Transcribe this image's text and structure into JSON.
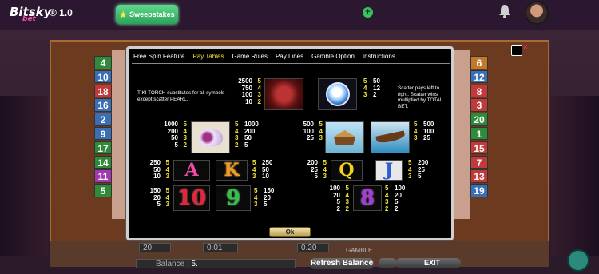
{
  "app": {
    "logo": "Bitsky",
    "logo_sub": "bet",
    "version": "® 1.0",
    "sweepstakes_label": "Sweepstakes",
    "icons": [
      "star-icon",
      "plus-icon",
      "bell-icon",
      "avatar"
    ]
  },
  "game": {
    "left_numbers": [
      "4",
      "10",
      "18",
      "16",
      "2",
      "9",
      "17",
      "14",
      "11",
      "5"
    ],
    "right_numbers": [
      "6",
      "12",
      "8",
      "3",
      "20",
      "1",
      "15",
      "7",
      "13",
      "19"
    ],
    "left_colors": [
      "#2f8a3a",
      "#3a6fb8",
      "#c03a3a",
      "#3a6fb8",
      "#3a6fb8",
      "#3a6fb8",
      "#2f8a3a",
      "#2f8a3a",
      "#a03ab0",
      "#2f8a3a"
    ],
    "right_colors": [
      "#c07a2a",
      "#3a6fb8",
      "#c03a3a",
      "#c03a3a",
      "#2f8a3a",
      "#2f8a3a",
      "#c03a3a",
      "#c03a3a",
      "#c03a3a",
      "#3a6fb8"
    ],
    "bottom": {
      "bet1": "20",
      "bet2": "0.01",
      "bet3": "0.20",
      "balance_label": "Balance :",
      "balance_value": "5.",
      "gamble_label": "GAMBLE",
      "refresh_label": "Refresh Balance",
      "exit_label": "EXIT"
    }
  },
  "dialog": {
    "tabs": [
      "Free Spin Feature",
      "Pay Tables",
      "Game Rules",
      "Pay Lines",
      "Gamble Option",
      "Instructions"
    ],
    "active_tab": "Pay Tables",
    "close_label": "×",
    "ok_label": "Ok",
    "tiki_text": "TIKI TORCH substitutes for all symbols except scatter PEARL.",
    "scatter_text": "Scatter pays left to right. Scatter wins multiplied by TOTAL BET.",
    "tiki": {
      "counts": [
        "5",
        "4",
        "3",
        "2"
      ],
      "values": [
        "2500",
        "750",
        "100",
        "10"
      ]
    },
    "pearl": {
      "counts": [
        "5",
        "4",
        "3"
      ],
      "values": [
        "50",
        "12",
        "2"
      ]
    },
    "shell": {
      "counts": [
        "5",
        "4",
        "3",
        "2"
      ],
      "values": [
        "1000",
        "200",
        "50",
        "5"
      ]
    },
    "hut": {
      "counts": [
        "5",
        "4",
        "3"
      ],
      "values": [
        "500",
        "100",
        "25"
      ]
    },
    "canoe": {
      "counts": [
        "5",
        "4",
        "3"
      ],
      "values": [
        "500",
        "100",
        "25"
      ]
    },
    "a": {
      "label": "A",
      "counts": [
        "5",
        "4",
        "3"
      ],
      "values": [
        "250",
        "50",
        "10"
      ]
    },
    "k": {
      "label": "K",
      "counts": [
        "5",
        "4",
        "3"
      ],
      "values": [
        "250",
        "50",
        "10"
      ]
    },
    "q": {
      "label": "Q",
      "counts": [
        "5",
        "4",
        "3"
      ],
      "values": [
        "200",
        "25",
        "5"
      ]
    },
    "j": {
      "label": "J",
      "counts": [
        "5",
        "4",
        "3"
      ],
      "values": [
        "200",
        "25",
        "5"
      ]
    },
    "ten": {
      "label": "10",
      "counts": [
        "5",
        "4",
        "3"
      ],
      "values": [
        "150",
        "20",
        "5"
      ]
    },
    "nine": {
      "label": "9",
      "counts": [
        "5",
        "4",
        "3"
      ],
      "values": [
        "150",
        "20",
        "5"
      ]
    },
    "eight": {
      "label": "8",
      "counts": [
        "5",
        "4",
        "3",
        "2"
      ],
      "values": [
        "100",
        "20",
        "5",
        "2"
      ]
    }
  }
}
